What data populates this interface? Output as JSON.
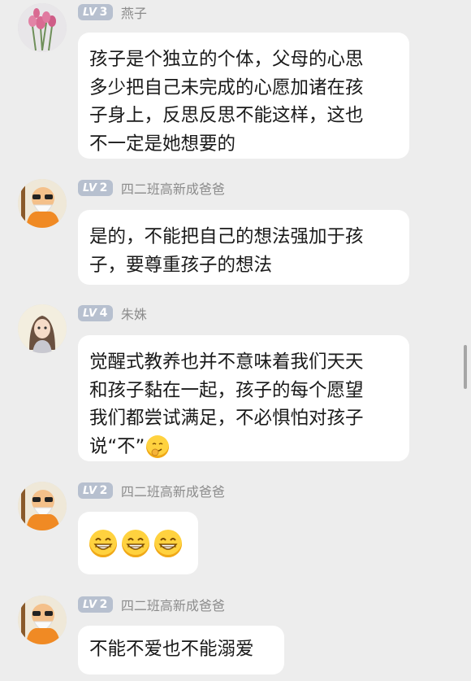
{
  "messages": [
    {
      "level_prefix": "LV",
      "level": "3",
      "name": "燕子",
      "avatar": "flower-avatar",
      "lines": [
        "孩子是个独立的个体，父母的心思",
        "多少把自己未完成的心愿加诸在孩",
        "子身上，反思反思不能这样，这也",
        "不一定是她想要的"
      ]
    },
    {
      "level_prefix": "LV",
      "level": "2",
      "name": "四二班高新成爸爸",
      "avatar": "cartoon-old-man-avatar",
      "lines": [
        "是的，不能把自己的想法强加于孩",
        "子，要尊重孩子的想法"
      ]
    },
    {
      "level_prefix": "LV",
      "level": "4",
      "name": "朱姝",
      "avatar": "girl-avatar",
      "lines": [
        "觉醒式教养也并不意味着我们天天",
        "和孩子黏在一起，孩子的每个愿望",
        "我们都尝试满足，不必惧怕对孩子",
        "说“不”"
      ],
      "trailing_emoji": "smirk-emoji"
    },
    {
      "level_prefix": "LV",
      "level": "2",
      "name": "四二班高新成爸爸",
      "avatar": "cartoon-old-man-avatar",
      "emojis": [
        "grin-emoji",
        "grin-emoji",
        "grin-emoji"
      ]
    },
    {
      "level_prefix": "LV",
      "level": "2",
      "name": "四二班高新成爸爸",
      "avatar": "cartoon-old-man-avatar",
      "lines": [
        "不能不爱也不能溺爱"
      ]
    }
  ],
  "colors": {
    "background": "#ededed",
    "bubble": "#ffffff",
    "level_badge": "#b7c0cf",
    "name_text": "#8c8c8c",
    "message_text": "#1a1a1a"
  }
}
